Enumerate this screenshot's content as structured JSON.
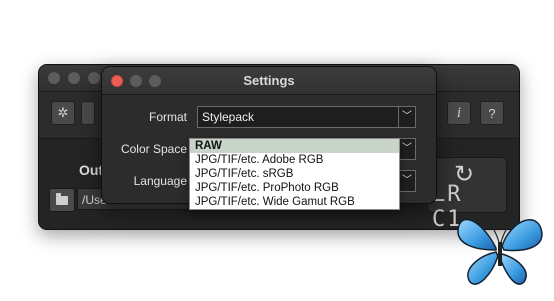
{
  "dialog": {
    "title": "Settings",
    "format": {
      "label": "Format",
      "value": "Stylepack"
    },
    "color_space": {
      "label": "Color Space",
      "options": [
        "RAW",
        "JPG/TIF/etc. Adobe RGB",
        "JPG/TIF/etc. sRGB",
        "JPG/TIF/etc. ProPhoto RGB",
        "JPG/TIF/etc. Wide Gamut RGB"
      ],
      "selected": "RAW"
    },
    "language": {
      "label": "Language"
    }
  },
  "main_window": {
    "output_label": "Out",
    "path_value": "/Use",
    "toolbar": {
      "info_label": "i",
      "help_label": "?"
    },
    "lrc1_label": "LR C1"
  },
  "colors": {
    "close_light": "#ec5f57",
    "selection": "#c9d4c9",
    "butterfly": "#3a9be0"
  },
  "icons": [
    "gear-icon",
    "folder-icon",
    "sync-arrow-icon",
    "chevron-down-icon",
    "butterfly-icon"
  ]
}
